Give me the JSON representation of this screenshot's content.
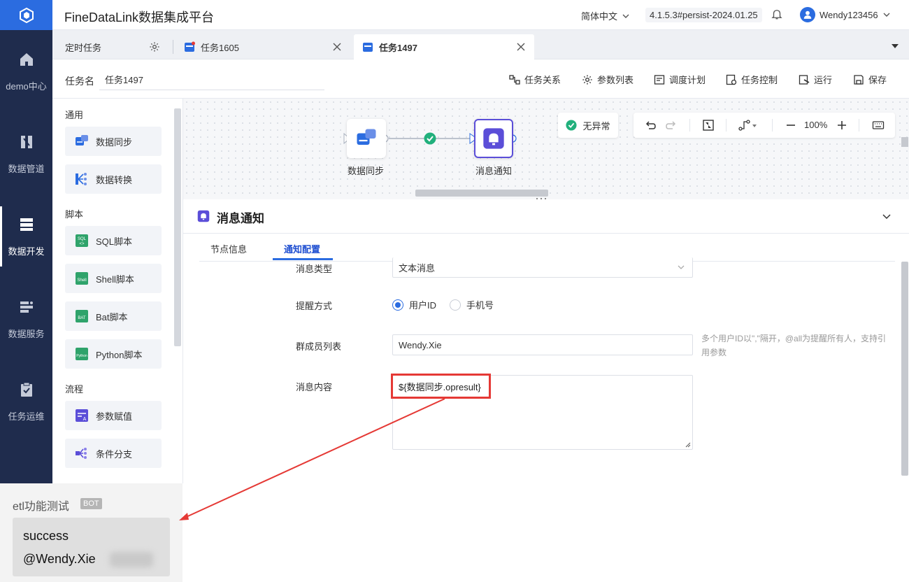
{
  "header": {
    "app_title": "FineDataLink数据集成平台",
    "language": "简体中文",
    "version": "4.1.5.3#persist-2024.01.25",
    "username": "Wendy123456"
  },
  "sidebar": {
    "items": [
      {
        "label": "demo中心",
        "icon": "home-icon"
      },
      {
        "label": "数据管道",
        "icon": "pipeline-icon"
      },
      {
        "label": "数据开发",
        "icon": "dev-icon",
        "active": true
      },
      {
        "label": "数据服务",
        "icon": "service-icon"
      },
      {
        "label": "任务运维",
        "icon": "ops-icon"
      }
    ]
  },
  "tabs": [
    {
      "label": "定时任务"
    },
    {
      "label": "任务1605"
    },
    {
      "label": "任务1497",
      "active": true
    }
  ],
  "task": {
    "name_label": "任务名",
    "name_value": "任务1497"
  },
  "toolbar": {
    "relation": "任务关系",
    "params": "参数列表",
    "schedule": "调度计划",
    "control": "任务控制",
    "run": "运行",
    "save": "保存"
  },
  "palette": {
    "sections": [
      {
        "heading": "通用",
        "items": [
          "数据同步",
          "数据转换"
        ]
      },
      {
        "heading": "脚本",
        "items": [
          "SQL脚本",
          "Shell脚本",
          "Bat脚本",
          "Python脚本"
        ]
      },
      {
        "heading": "流程",
        "items": [
          "参数赋值",
          "条件分支"
        ]
      }
    ]
  },
  "canvas": {
    "nodes": [
      {
        "label": "数据同步"
      },
      {
        "label": "消息通知"
      }
    ],
    "status": "无异常",
    "zoom": "100%"
  },
  "panel": {
    "title": "消息通知",
    "tabs": [
      "节点信息",
      "通知配置"
    ],
    "active_tab": "通知配置",
    "fields": {
      "msg_type_label": "消息类型",
      "msg_type_value": "文本消息",
      "remind_label": "提醒方式",
      "remind_option1": "用户ID",
      "remind_option2": "手机号",
      "members_label": "群成员列表",
      "members_value": "Wendy.Xie",
      "members_hint": "多个用户ID以\",\"隔开，@all为提醒所有人，支持引用参数",
      "content_label": "消息内容",
      "content_value": "${数据同步.opresult}"
    }
  },
  "chat": {
    "bot_name": "etl功能测试",
    "bot_badge": "BOT",
    "line1": "success",
    "line2": "@Wendy.Xie"
  },
  "colors": {
    "nav_bg": "#1f2c4d",
    "accent": "#2b6ce0",
    "node_purple": "#5b4ed8",
    "success_green": "#21b07c",
    "highlight_red": "#e53935"
  }
}
